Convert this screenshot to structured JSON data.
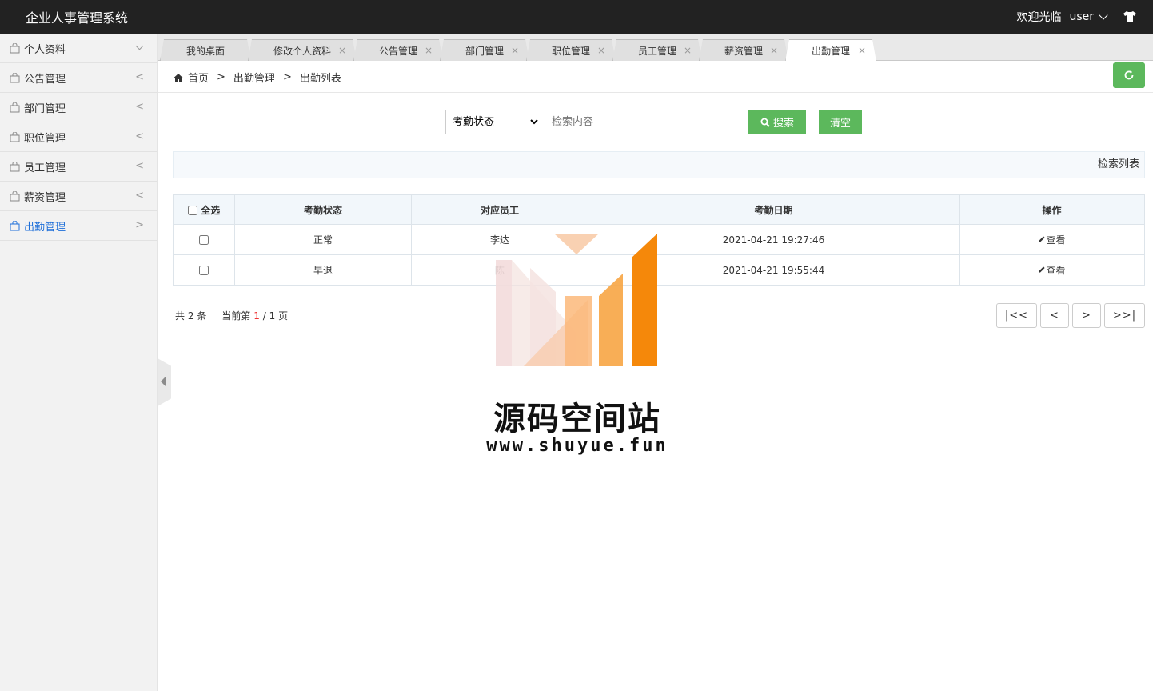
{
  "header": {
    "title": "企业人事管理系统",
    "welcome": "欢迎光临",
    "user": "user"
  },
  "sidebar": {
    "items": [
      {
        "label": "个人资料",
        "arrow": "down"
      },
      {
        "label": "公告管理",
        "arrow": "<"
      },
      {
        "label": "部门管理",
        "arrow": "<"
      },
      {
        "label": "职位管理",
        "arrow": "<"
      },
      {
        "label": "员工管理",
        "arrow": "<"
      },
      {
        "label": "薪资管理",
        "arrow": "<"
      },
      {
        "label": "出勤管理",
        "arrow": ">"
      }
    ]
  },
  "tabs": [
    "我的桌面",
    "修改个人资料",
    "公告管理",
    "部门管理",
    "职位管理",
    "员工管理",
    "薪资管理",
    "出勤管理"
  ],
  "tab_close": "×",
  "breadcrumb": {
    "home": "首页",
    "section": "出勤管理",
    "page": "出勤列表",
    "sep": ">"
  },
  "search": {
    "select_value": "考勤状态",
    "placeholder": "检索内容",
    "search_label": "搜索",
    "clear_label": "清空"
  },
  "list_title": "检索列表",
  "table": {
    "headers": {
      "select_all": "全选",
      "status": "考勤状态",
      "employee": "对应员工",
      "date": "考勤日期",
      "action": "操作"
    },
    "rows": [
      {
        "status": "正常",
        "employee": "李达",
        "date": "2021-04-21 19:27:46",
        "action": "查看"
      },
      {
        "status": "早退",
        "employee": "陈",
        "date": "2021-04-21 19:55:44",
        "action": "查看"
      }
    ]
  },
  "pagination": {
    "total_prefix": "共",
    "total": "2",
    "total_suffix": "条",
    "current_prefix": "当前第",
    "current": "1",
    "slash": "/",
    "pages": "1",
    "pages_suffix": "页",
    "first": "|<<",
    "prev": "<",
    "next": ">",
    "last": ">>|"
  },
  "watermark": {
    "title": "源码空间站",
    "url": "www.shuyue.fun"
  },
  "colors": {
    "topbar": "#222222",
    "accent_green": "#5cb85c",
    "active_link": "#1e6fd9",
    "watermark_orange": "#f5880a"
  }
}
